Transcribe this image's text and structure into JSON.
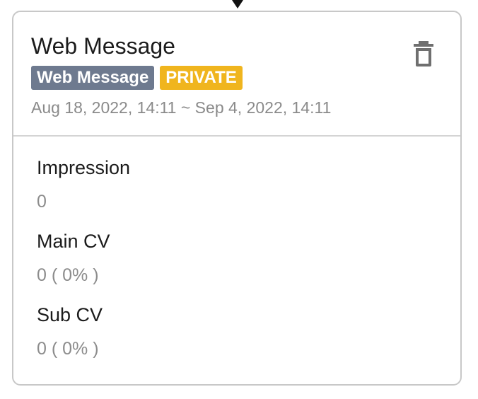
{
  "card": {
    "title": "Web Message",
    "type_badge": "Web Message",
    "status_badge": "PRIVATE",
    "date_range": "Aug 18, 2022, 14:11 ~ Sep 4, 2022, 14:11",
    "icons": {
      "delete": "trash-icon",
      "connector": "arrow-down-icon"
    },
    "colors": {
      "type_badge": "#6e7a8f",
      "status_badge": "#f0b51e"
    }
  },
  "metrics": [
    {
      "label": "Impression",
      "value": "0"
    },
    {
      "label": "Main CV",
      "value": "0 ( 0% )"
    },
    {
      "label": "Sub CV",
      "value": "0 ( 0% )"
    }
  ]
}
